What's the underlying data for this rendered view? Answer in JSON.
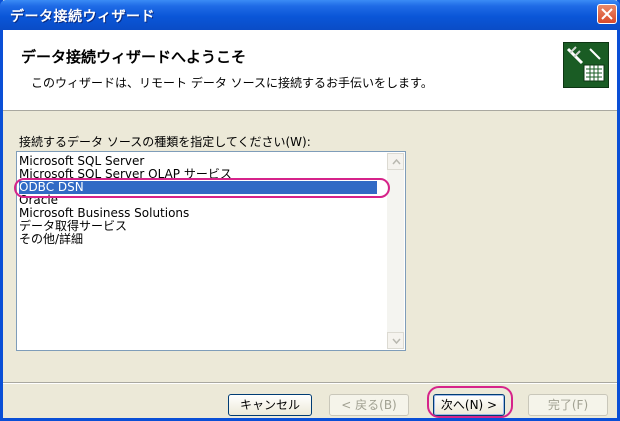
{
  "window": {
    "title": "データ接続ウィザード"
  },
  "header": {
    "heading": "データ接続ウィザードへようこそ",
    "subheading": "このウィザードは、リモート データ ソースに接続するお手伝いをします。",
    "icon": "data-connection-icon"
  },
  "list": {
    "label": "接続するデータ ソースの種類を指定してください(W):",
    "items": [
      "Microsoft SQL Server",
      "Microsoft SQL Server OLAP サービス",
      "ODBC DSN",
      "Oracle",
      "Microsoft Business Solutions",
      "データ取得サービス",
      "その他/詳細"
    ],
    "selected_index": 2
  },
  "buttons": {
    "cancel": "キャンセル",
    "back": "< 戻る(B)",
    "next": "次へ(N) >",
    "finish": "完了(F)"
  },
  "colors": {
    "selection": "#316ac5",
    "annotation": "#d6238a",
    "titlebar": "#0a56d8"
  }
}
